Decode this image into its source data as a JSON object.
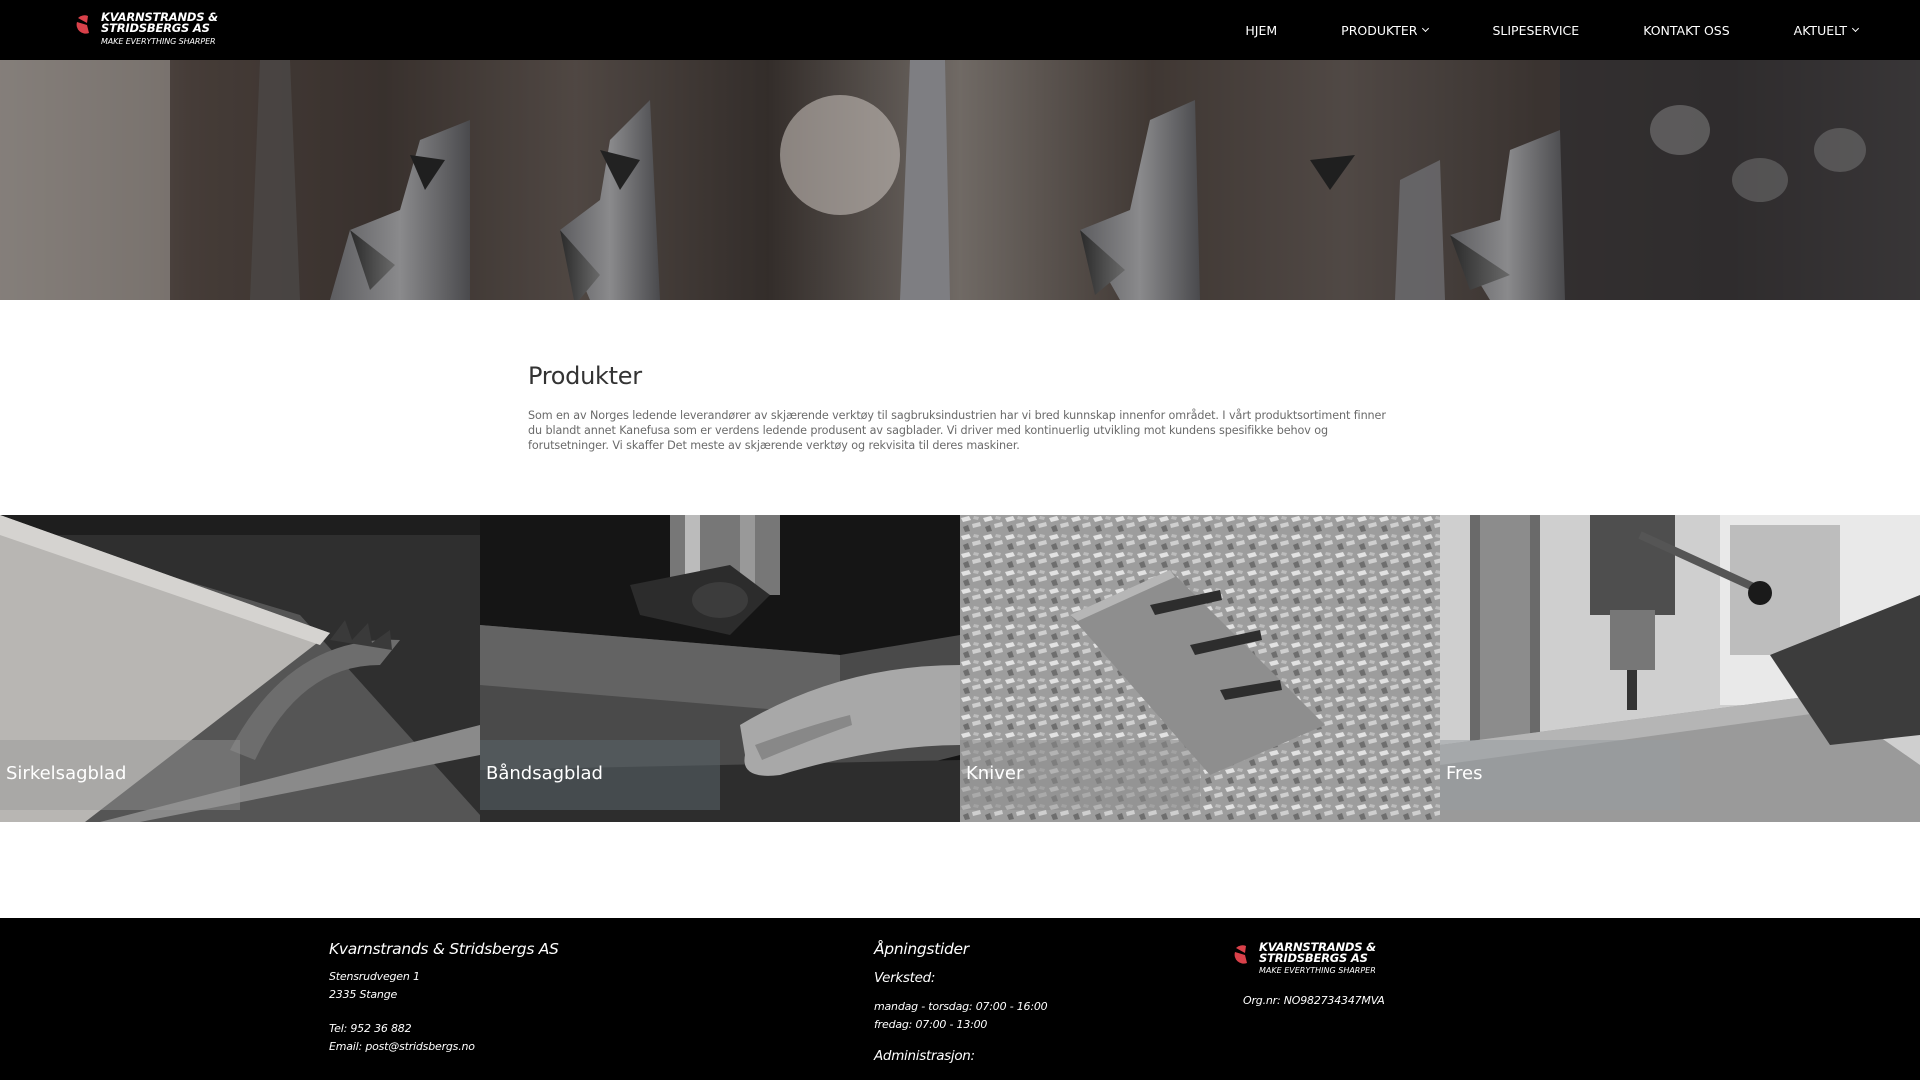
{
  "header": {
    "logo": {
      "line1": "KVARNSTRANDS &",
      "line2": "STRIDSBERGS AS",
      "tagline": "MAKE EVERYTHING SHARPER"
    },
    "nav": [
      {
        "label": "HJEM",
        "has_dropdown": false
      },
      {
        "label": "PRODUKTER",
        "has_dropdown": true
      },
      {
        "label": "SLIPESERVICE",
        "has_dropdown": false
      },
      {
        "label": "KONTAKT OSS",
        "has_dropdown": false
      },
      {
        "label": "AKTUELT",
        "has_dropdown": true
      }
    ]
  },
  "intro": {
    "title": "Produkter",
    "body": "Som en av Norges ledende leverandører av skjærende verktøy til sagbruksindustrien har vi bred kunnskap innenfor området. I vårt produktsortiment finner du blandt annet Kanefusa som er verdens ledende produsent av sagblader. Vi driver med kontinuerlig utvikling mot kundens spesifikke behov og forutsetninger. Vi skaffer Det meste av skjærende verktøy og rekvisita til deres maskiner."
  },
  "products": [
    {
      "label": "Sirkelsagblad"
    },
    {
      "label": "Båndsagblad"
    },
    {
      "label": "Kniver"
    },
    {
      "label": "Fres"
    }
  ],
  "footer": {
    "company": {
      "name": "Kvarnstrands & Stridsbergs AS",
      "address1": "Stensrudvegen 1",
      "address2": "2335 Stange",
      "phone": "Tel: 952 36 882",
      "email": "Email: post@stridsbergs.no"
    },
    "hours": {
      "title": "Åpningstider",
      "workshop_title": "Verksted:",
      "workshop_line1": "mandag - torsdag: 07:00 - 16:00",
      "workshop_line2": "fredag: 07:00 - 13:00",
      "admin_title": "Administrasjon:"
    },
    "brand": {
      "line1": "KVARNSTRANDS &",
      "line2": "STRIDSBERGS AS",
      "tagline": "MAKE EVERYTHING SHARPER",
      "org": "Org.nr: NO982734347MVA"
    }
  },
  "colors": {
    "header_bg": "#000000",
    "footer_bg": "#000000",
    "logo_accent": "#d9414a",
    "label_overlay": "rgba(128,128,128,0.45)"
  }
}
